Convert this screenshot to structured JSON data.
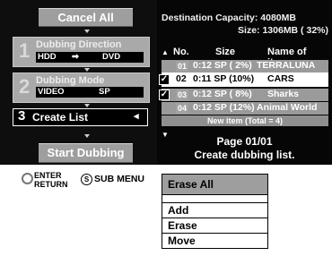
{
  "left": {
    "cancel_all": "Cancel All",
    "step1": {
      "num": "1",
      "title": "Dubbing Direction",
      "from": "HDD",
      "arrow": "➡",
      "to": "DVD"
    },
    "step2": {
      "num": "2",
      "title": "Dubbing Mode",
      "mode": "VIDEO",
      "quality": "SP"
    },
    "step3": {
      "num": "3",
      "title": "Create List",
      "arrow": "◂"
    },
    "start_dubbing": "Start Dubbing"
  },
  "right": {
    "capacity_line1": "Destination Capacity: 4080MB",
    "capacity_line2": "Size: 1306MB ( 32%)",
    "headers": {
      "arrow": "▲",
      "no": "No.",
      "size": "Size",
      "name": "Name of item"
    },
    "rows": [
      {
        "check": "",
        "badge": "01",
        "size": "0:12 SP ( 2%)",
        "name": "TERRALUNA"
      },
      {
        "check": "✓",
        "badge": "02",
        "size": "0:11 SP (10%)",
        "name": "CARS"
      },
      {
        "check": "✓",
        "badge": "03",
        "size": "0:12 SP ( 8%)",
        "name": "Sharks"
      },
      {
        "check": "",
        "badge": "04",
        "size": "0:12 SP (12%)",
        "name": "Animal World"
      }
    ],
    "new_item": "New item  (Total = 4)",
    "down_arrow": "▼",
    "page": "Page 01/01",
    "instruction": "Create dubbing list."
  },
  "legend": {
    "enter": "ENTER",
    "return": "RETURN",
    "s_label": "S",
    "sub_menu": "SUB MENU"
  },
  "menu": {
    "header": "Erase All",
    "items": [
      "Add",
      "Erase",
      "Move"
    ]
  }
}
